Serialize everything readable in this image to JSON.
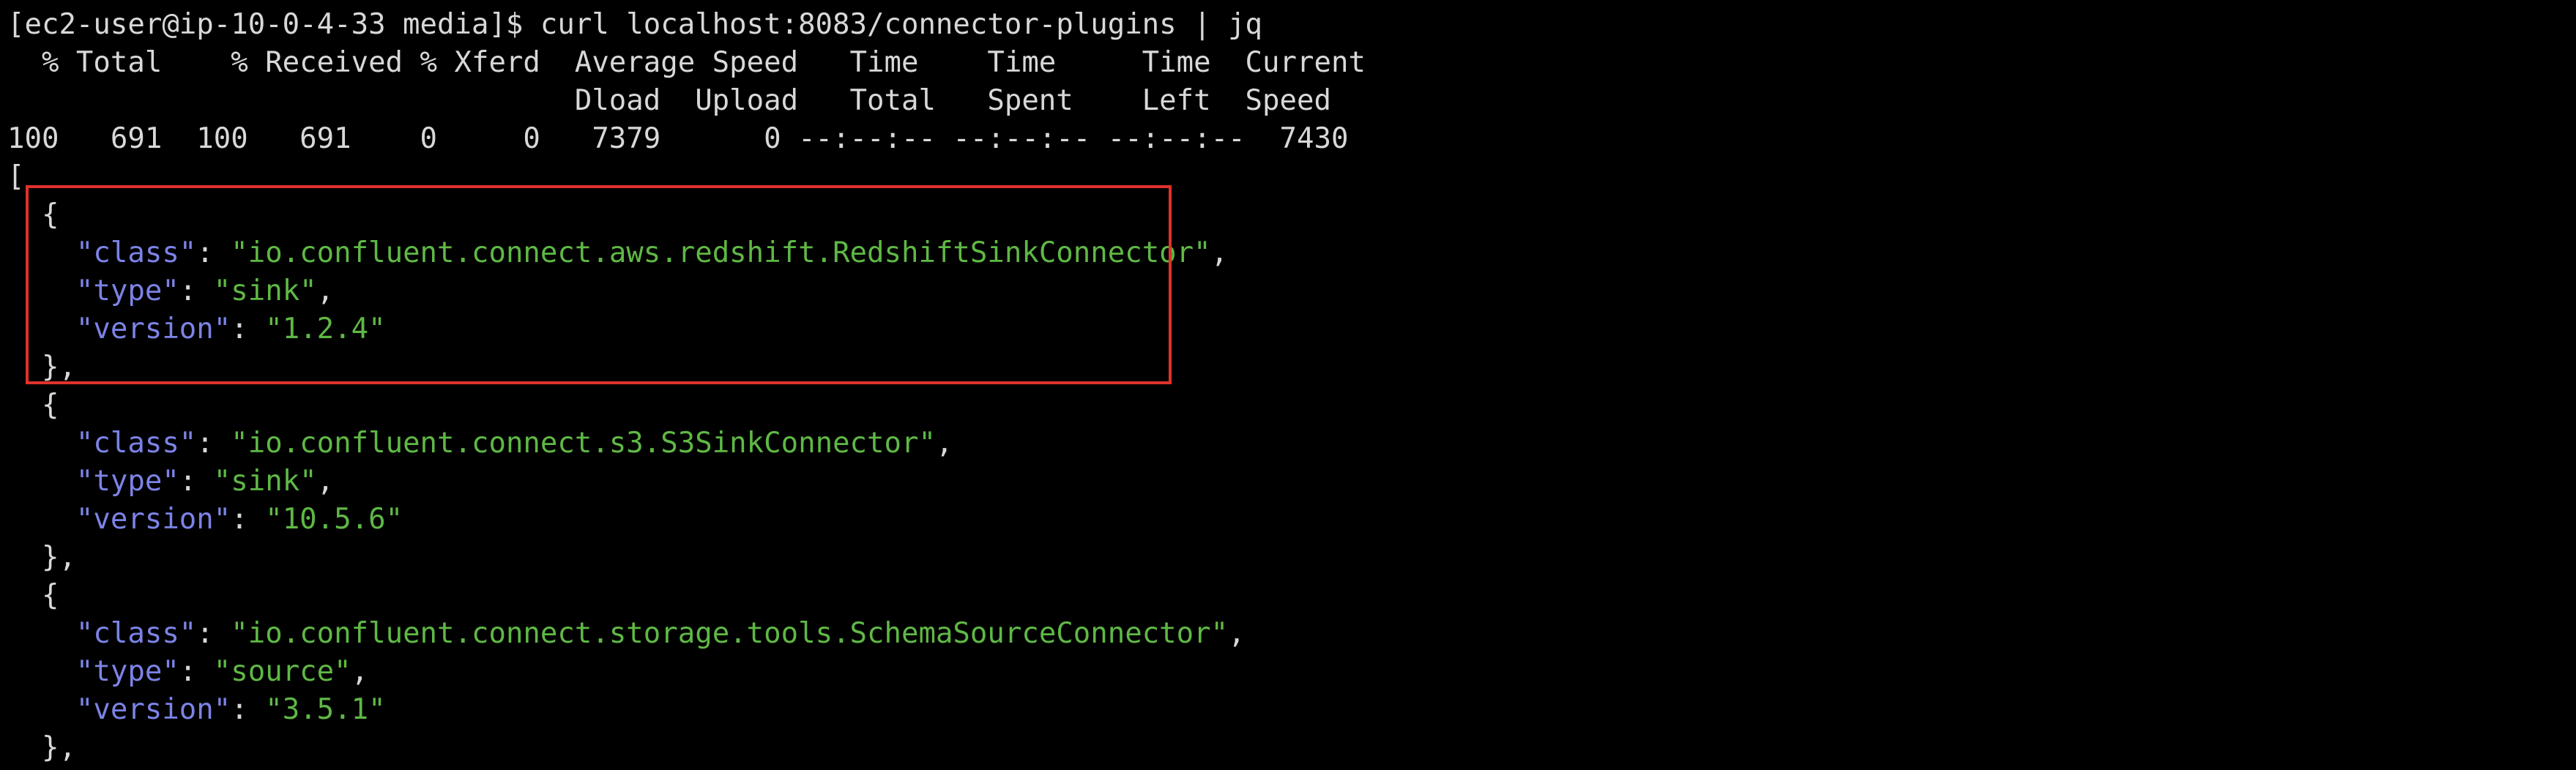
{
  "terminal": {
    "prompt_line": "[ec2-user@ip-10-0-4-33 media]$ curl localhost:8083/connector-plugins | jq",
    "progress_header_1": "  % Total    % Received % Xferd  Average Speed   Time    Time     Time  Current",
    "progress_header_2": "                                 Dload  Upload   Total   Spent    Left  Speed",
    "progress_values": "100   691  100   691    0     0   7379      0 --:--:-- --:--:-- --:--:--  7430",
    "open_bracket": "[",
    "plugins": [
      {
        "class": "io.confluent.connect.aws.redshift.RedshiftSinkConnector",
        "type": "sink",
        "version": "1.2.4"
      },
      {
        "class": "io.confluent.connect.s3.S3SinkConnector",
        "type": "sink",
        "version": "10.5.6"
      },
      {
        "class": "io.confluent.connect.storage.tools.SchemaSourceConnector",
        "type": "source",
        "version": "3.5.1"
      }
    ],
    "keys": {
      "class": "\"class\"",
      "type": "\"type\"",
      "version": "\"version\""
    },
    "q": {
      "p0_class": "\"io.confluent.connect.aws.redshift.RedshiftSinkConnector\"",
      "p0_type": "\"sink\"",
      "p0_version": "\"1.2.4\"",
      "p1_class": "\"io.confluent.connect.s3.S3SinkConnector\"",
      "p1_type": "\"sink\"",
      "p1_version": "\"10.5.6\"",
      "p2_class": "\"io.confluent.connect.storage.tools.SchemaSourceConnector\"",
      "p2_type": "\"source\"",
      "p2_version": "\"3.5.1\""
    },
    "open_brace": "  {",
    "close_brace": "  },",
    "colon": ": ",
    "comma": ",",
    "indent": "    "
  },
  "colors": {
    "background": "#000000",
    "text": "#d8d8d8",
    "json_key": "#7c83e6",
    "json_string": "#5fb845",
    "highlight_border": "#e0322a"
  }
}
